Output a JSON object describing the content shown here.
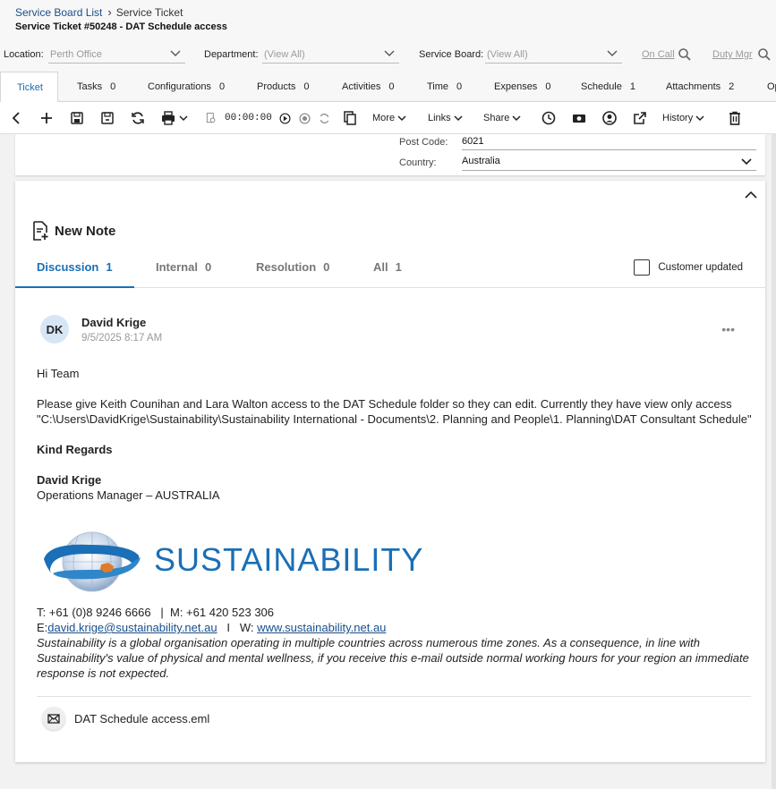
{
  "breadcrumb": {
    "root": "Service Board List",
    "current": "Service Ticket"
  },
  "ticket_title": "Service Ticket #50248 - DAT Schedule access",
  "filters": {
    "location_label": "Location:",
    "location_value": "Perth Office",
    "department_label": "Department:",
    "department_value": "(View All)",
    "board_label": "Service Board:",
    "board_value": "(View All)",
    "on_call": "On Call",
    "duty_mgr": "Duty Mgr"
  },
  "tabs": [
    {
      "label": "Ticket",
      "count": ""
    },
    {
      "label": "Tasks",
      "count": "0"
    },
    {
      "label": "Configurations",
      "count": "0"
    },
    {
      "label": "Products",
      "count": "0"
    },
    {
      "label": "Activities",
      "count": "0"
    },
    {
      "label": "Time",
      "count": "0"
    },
    {
      "label": "Expenses",
      "count": "0"
    },
    {
      "label": "Schedule",
      "count": "1"
    },
    {
      "label": "Attachments",
      "count": "2"
    },
    {
      "label": "Op",
      "count": ""
    }
  ],
  "toolbar": {
    "timer": "00:00:00",
    "more": "More",
    "links": "Links",
    "share": "Share",
    "history": "History"
  },
  "address": {
    "postcode_label": "Post Code:",
    "postcode_value": "6021",
    "country_label": "Country:",
    "country_value": "Australia"
  },
  "notes": {
    "new_note": "New Note",
    "tabs": [
      {
        "label": "Discussion",
        "count": "1"
      },
      {
        "label": "Internal",
        "count": "0"
      },
      {
        "label": "Resolution",
        "count": "0"
      },
      {
        "label": "All",
        "count": "1"
      }
    ],
    "customer_updated": "Customer updated"
  },
  "note": {
    "initials": "DK",
    "author": "David Krige",
    "date": "9/5/2025 8:17 AM",
    "greeting": "Hi Team",
    "message": "Please give Keith Counihan and Lara Walton access to the DAT Schedule folder so they can edit. Currently they have view only access \"C:\\Users\\DavidKrige\\Sustainability\\Sustainability International - Documents\\2. Planning and People\\1. Planning\\DAT Consultant Schedule\"",
    "closing": "Kind Regards",
    "sig_name": "David Krige",
    "sig_title": "Operations Manager – AUSTRALIA",
    "logo_text": "SUSTAINABILITY",
    "phone_line": "T: +61 (0)8 9246 6666   |  M: +61 420 523 306",
    "email_prefix": "E:",
    "email": "david.krige@sustainability.net.au",
    "web_prefix": "   I   W: ",
    "web": "www.sustainability.net.au",
    "disclaimer": "Sustainability is a global organisation operating in multiple countries across numerous time zones. As a consequence, in line with Sustainability's value of physical and mental wellness, if you receive this e-mail outside normal working hours for your region an immediate response is not expected.",
    "attachment": "DAT Schedule access.eml"
  },
  "colors": {
    "accent": "#1a6fb6",
    "link": "#1a4f8b"
  }
}
